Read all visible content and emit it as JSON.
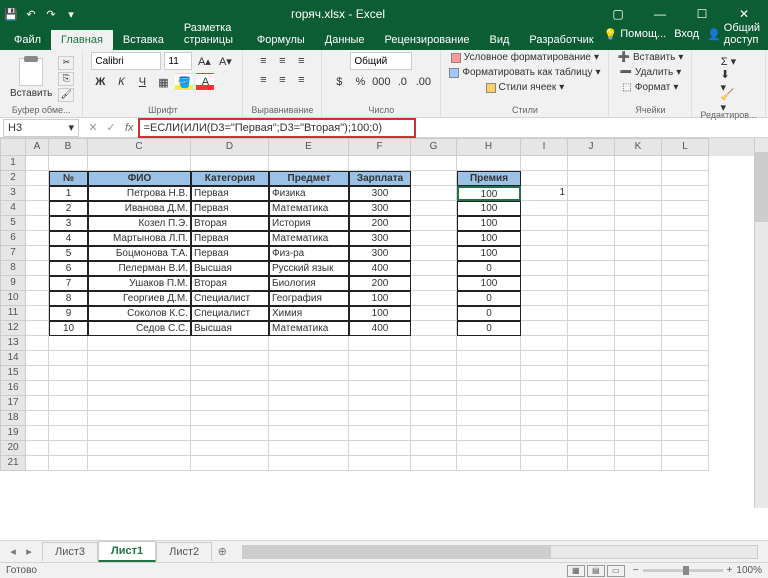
{
  "title": "горяч.xlsx - Excel",
  "qat": {
    "save": "💾",
    "undo": "↶",
    "redo": "↷",
    "custom": "▾"
  },
  "win": {
    "min": "—",
    "max": "☐",
    "close": "✕",
    "ribmin": "▢"
  },
  "tabs": {
    "file": "Файл",
    "home": "Главная",
    "insert": "Вставка",
    "layout": "Разметка страницы",
    "formulas": "Формулы",
    "data": "Данные",
    "review": "Рецензирование",
    "view": "Вид",
    "dev": "Разработчик"
  },
  "help": {
    "tell": "Помощ...",
    "signin": "Вход",
    "share": "Общий доступ"
  },
  "ribbon": {
    "clipboard": {
      "label": "Буфер обме...",
      "paste": "Вставить"
    },
    "font": {
      "label": "Шрифт",
      "name": "Calibri",
      "size": "11",
      "bold": "Ж",
      "italic": "К",
      "underline": "Ч"
    },
    "align": {
      "label": "Выравнивание"
    },
    "number": {
      "label": "Число",
      "format": "Общий"
    },
    "styles": {
      "label": "Стили",
      "cond": "Условное форматирование",
      "table": "Форматировать как таблицу",
      "cell": "Стили ячеек"
    },
    "cells": {
      "label": "Ячейки",
      "insert": "Вставить",
      "delete": "Удалить",
      "format": "Формат"
    },
    "edit": {
      "label": "Редактиров..."
    }
  },
  "namebox": "H3",
  "formula": "=ЕСЛИ(ИЛИ(D3=\"Первая\";D3=\"Вторая\");100;0)",
  "colLabels": [
    "A",
    "B",
    "C",
    "D",
    "E",
    "F",
    "G",
    "H",
    "I",
    "J",
    "K",
    "L"
  ],
  "headers": {
    "b": "№",
    "c": "ФИО",
    "d": "Категория",
    "e": "Предмет",
    "f": "Зарплата",
    "h": "Премия"
  },
  "rows": [
    {
      "n": "1",
      "fio": "Петрова Н.В.",
      "cat": "Первая",
      "subj": "Физика",
      "sal": "300",
      "bonus": "100",
      "i": "1"
    },
    {
      "n": "2",
      "fio": "Иванова Д.М.",
      "cat": "Первая",
      "subj": "Математика",
      "sal": "300",
      "bonus": "100",
      "i": ""
    },
    {
      "n": "3",
      "fio": "Козел П.Э.",
      "cat": "Вторая",
      "subj": "История",
      "sal": "200",
      "bonus": "100",
      "i": ""
    },
    {
      "n": "4",
      "fio": "Мартынова Л.П.",
      "cat": "Первая",
      "subj": "Математика",
      "sal": "300",
      "bonus": "100",
      "i": ""
    },
    {
      "n": "5",
      "fio": "Боцмонова Т.А.",
      "cat": "Первая",
      "subj": "Физ-ра",
      "sal": "300",
      "bonus": "100",
      "i": ""
    },
    {
      "n": "6",
      "fio": "Пелерман В.И.",
      "cat": "Высшая",
      "subj": "Русский язык",
      "sal": "400",
      "bonus": "0",
      "i": ""
    },
    {
      "n": "7",
      "fio": "Ушаков П.М.",
      "cat": "Вторая",
      "subj": "Биология",
      "sal": "200",
      "bonus": "100",
      "i": ""
    },
    {
      "n": "8",
      "fio": "Георгиев Д.М.",
      "cat": "Специалист",
      "subj": "География",
      "sal": "100",
      "bonus": "0",
      "i": ""
    },
    {
      "n": "9",
      "fio": "Соколов К.С.",
      "cat": "Специалист",
      "subj": "Химия",
      "sal": "100",
      "bonus": "0",
      "i": ""
    },
    {
      "n": "10",
      "fio": "Седов С.С.",
      "cat": "Высшая",
      "subj": "Математика",
      "sal": "400",
      "bonus": "0",
      "i": ""
    }
  ],
  "sheets": {
    "s3": "Лист3",
    "s1": "Лист1",
    "s2": "Лист2"
  },
  "status": {
    "ready": "Готово",
    "zoom": "100%"
  }
}
